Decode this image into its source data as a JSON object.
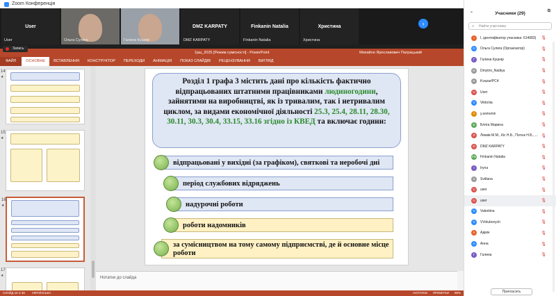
{
  "window": {
    "title": "Zoom Конференція"
  },
  "video_strip": {
    "tiles": [
      {
        "label": "User",
        "name": "User"
      },
      {
        "label": "",
        "name": "Ольга Сулига"
      },
      {
        "label": "",
        "name": "Галина Кушнір"
      },
      {
        "label": "DMZ KARPATY",
        "name": "DMZ KARPATY"
      },
      {
        "label": "Finkanin Natalia",
        "name": "Finkanin Natalia"
      },
      {
        "label": "Христина",
        "name": "Христина"
      }
    ],
    "next_icon": "chevron-right-icon"
  },
  "recording": {
    "label": "Запись"
  },
  "powerpoint": {
    "file_title": "1рш_2025 [Режим сумісності] - PowerPoint",
    "user": "Михайло Ярославович Патрацький",
    "ribbon_tabs": [
      "ФАЙЛ",
      "ОСНОВНЕ",
      "ВСТАВЛЕННЯ",
      "КОНСТРУКТОР",
      "ПЕРЕХОДИ",
      "АНІМАЦІЯ",
      "ПОКАЗ СЛАЙДІВ",
      "РЕЦЕНЗУВАННЯ",
      "ВИГЛЯД"
    ],
    "thumbnails": [
      {
        "num": "14"
      },
      {
        "num": "15"
      },
      {
        "num": "16"
      },
      {
        "num": "17"
      }
    ],
    "slide": {
      "heading_part1": "Розділ 1 графа 3  містить дані про кількість фактично відпрацьованих штатними працівниками",
      "heading_green": "людиногодини",
      "heading_part2": ", зайнятими на виробництві, як із тривалим, так і нетривалим циклом, за видами економічної діяльності",
      "heading_codes": "25.3, 25.4, 28.11, 28.30, 30.11, 30.3, 30.4, 33.15, 33.16 згідно із КВЕД",
      "heading_end": "та включає години:",
      "items": [
        "відпрацьовані у вихідні (за графіком), святкові та неробочі дні",
        "період службових відряджень",
        "надурочні роботи",
        "роботи надомників",
        "за сумісництвом на тому самому підприємстві, де й основне місце роботи"
      ]
    },
    "notes_placeholder": "Нотатки до слайда",
    "status": {
      "slide": "СЛАЙД 16 З 36",
      "lang": "УКРАЇНСЬКА",
      "notes": "НОТАТКИ",
      "comments": "ПРИМІТКИ",
      "zoom": "95%"
    }
  },
  "participants": {
    "title": "Учасники (29)",
    "search_placeholder": "Найти участника",
    "list": [
      {
        "name": "I, ідентифікатор учасника: 614683)",
        "initial": "I",
        "color": "#e8612c"
      },
      {
        "name": "Ольга Сулига (Організатор)",
        "initial": "О",
        "color": "#2d8cff"
      },
      {
        "name": "Галина Кушнір",
        "initial": "Г",
        "color": "#7a5cc2"
      },
      {
        "name": "Dmytriv_Nadiya",
        "initial": "D",
        "color": "#9a9a9a"
      },
      {
        "name": "Kvazar/PC4",
        "initial": "K",
        "color": "#9a9a9a"
      },
      {
        "name": "User",
        "initial": "U",
        "color": "#d9534f"
      },
      {
        "name": "Viktoriia",
        "initial": "V",
        "color": "#2d8cff"
      },
      {
        "name": "y.semenin",
        "initial": "Y",
        "color": "#e08a00"
      },
      {
        "name": "Бляга Марина",
        "initial": "Б",
        "color": "#5ba85a"
      },
      {
        "name": "Левків М.М., Кіс Н.Б., Потюк Н.Б., ...",
        "initial": "Л",
        "color": "#d9534f"
      },
      {
        "name": "DMZ KARPATY",
        "initial": "D",
        "color": "#d9534f"
      },
      {
        "name": "Finkanin Natalia",
        "initial": "FN",
        "color": "#5ba85a"
      },
      {
        "name": "Iryna",
        "initial": "I",
        "color": "#7a5cc2"
      },
      {
        "name": "Svitlana",
        "initial": "S",
        "color": "#9a9a9a"
      },
      {
        "name": "user",
        "initial": "U",
        "color": "#d9534f"
      },
      {
        "name": "user",
        "initial": "U",
        "color": "#d9534f"
      },
      {
        "name": "Valentina",
        "initial": "V",
        "color": "#2d8cff"
      },
      {
        "name": "VVolubovych",
        "initial": "V",
        "color": "#2d8cff"
      },
      {
        "name": "Адмін",
        "initial": "А",
        "color": "#e8612c"
      },
      {
        "name": "Анна",
        "initial": "А",
        "color": "#2d8cff"
      },
      {
        "name": "Галина",
        "initial": "Г",
        "color": "#7a5cc2"
      }
    ],
    "invite_label": "Пригласить"
  }
}
